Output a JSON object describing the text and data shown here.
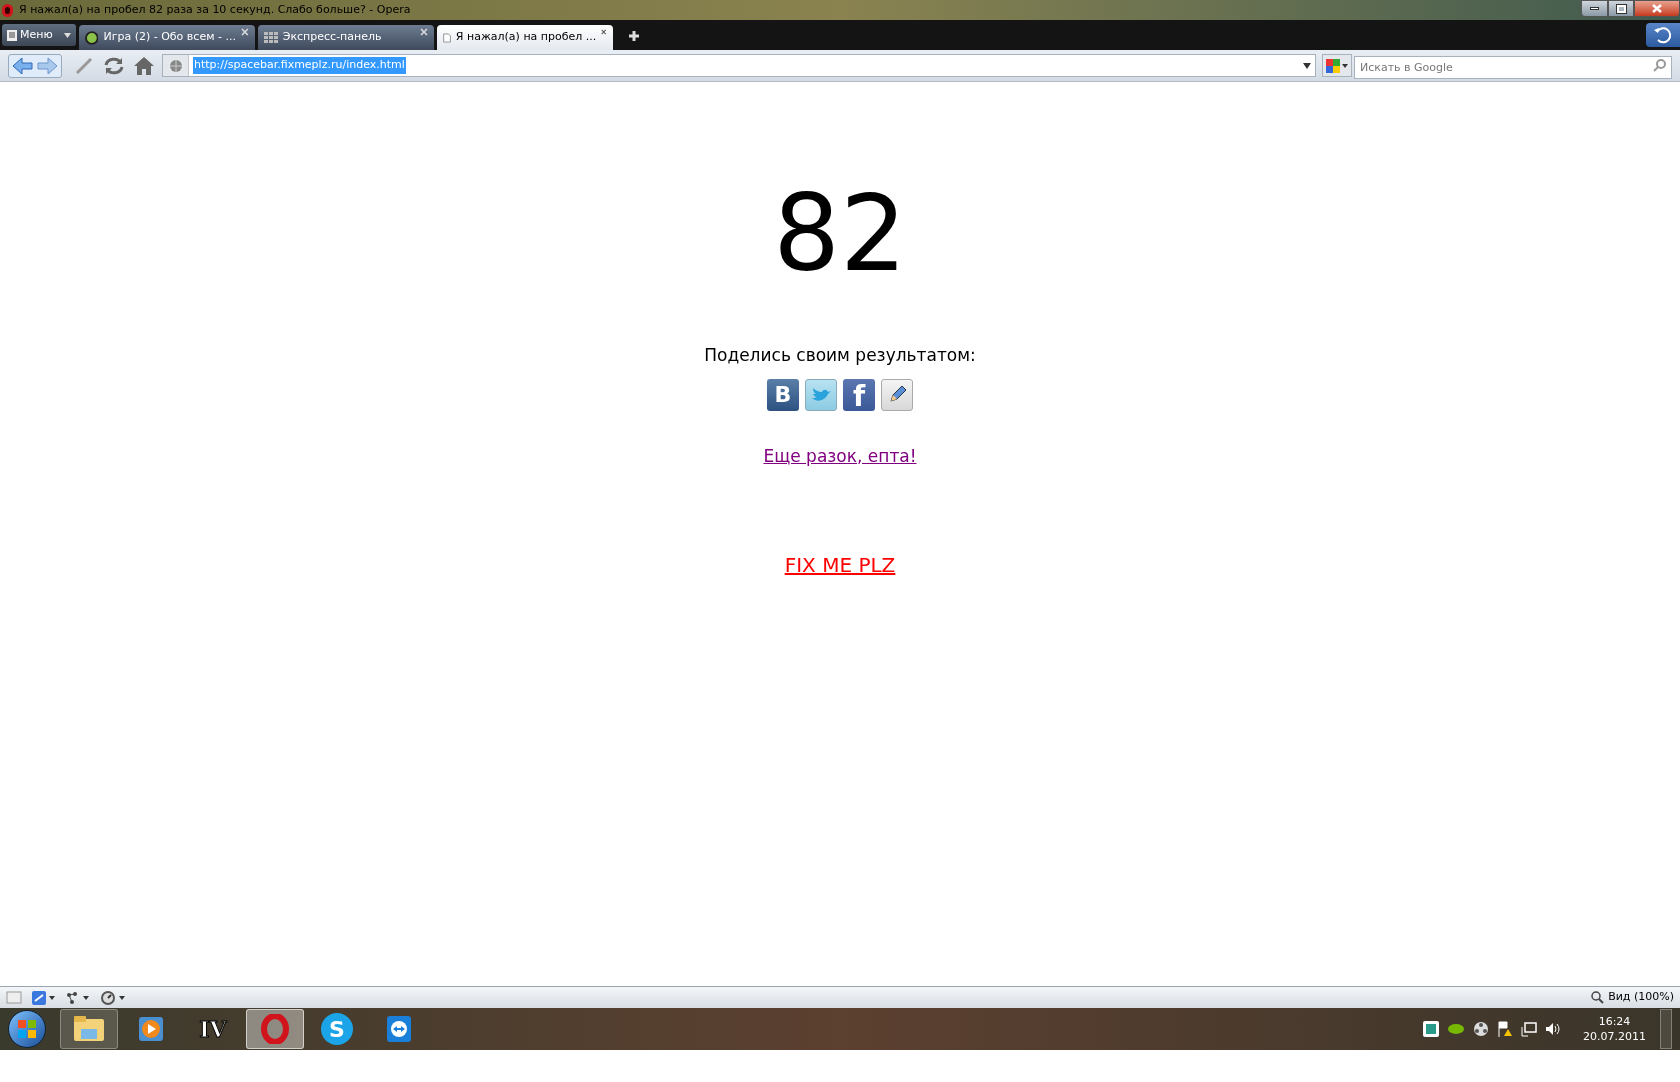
{
  "window": {
    "title": "Я нажал(а) на пробел 82 раза за 10 секунд. Слабо больше? - Opera"
  },
  "menu_button": {
    "label": "Меню"
  },
  "tabs": [
    {
      "kind": "site",
      "label": "Игра (2) - Обо всем - ...",
      "selected": false
    },
    {
      "kind": "speeddial",
      "label": "Экспресс-панель",
      "selected": false
    },
    {
      "kind": "page",
      "label": "Я нажал(а) на пробел ...",
      "selected": true
    }
  ],
  "address_bar": {
    "value": "http://spacebar.fixmeplz.ru/index.html"
  },
  "search": {
    "placeholder": "Искать в Google"
  },
  "page": {
    "score": "82",
    "share_label": "Поделись своим результатом:",
    "share_buttons": [
      {
        "kind": "vk",
        "label": "B"
      },
      {
        "kind": "twitter"
      },
      {
        "kind": "facebook",
        "label": "f"
      },
      {
        "kind": "edit"
      }
    ],
    "again_link": "Еще разок, епта!",
    "fix_link": "FIX ME PLZ"
  },
  "status_bar": {
    "zoom": "Вид (100%)"
  },
  "taskbar": {
    "apps": [
      {
        "kind": "explorer",
        "selected": false
      },
      {
        "kind": "media"
      },
      {
        "kind": "iv",
        "label": "IV"
      },
      {
        "kind": "opera",
        "selected": true
      },
      {
        "kind": "skype",
        "label": "S"
      },
      {
        "kind": "teamviewer"
      }
    ],
    "time": "16:24",
    "date": "20.07.2011"
  }
}
